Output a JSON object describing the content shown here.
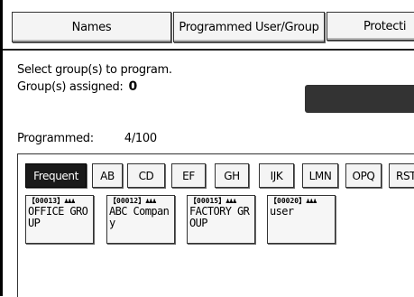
{
  "tabs": [
    "Names",
    "Programmed User/Group",
    "Protecti"
  ],
  "instruction": "Select group(s) to program.",
  "assigned_label": "Group(s) assigned:",
  "assigned_count": "0",
  "programmed_label": "Programmed:",
  "programmed_value": "4/100",
  "index_keys": [
    "Frequent",
    "AB",
    "CD",
    "EF",
    "GH",
    "IJK",
    "LMN",
    "OPQ",
    "RST"
  ],
  "active_index": "Frequent",
  "entries": [
    {
      "code": "【00013】",
      "icon": "group-icon",
      "name": "OFFICE GROUP"
    },
    {
      "code": "【00012】",
      "icon": "group-icon",
      "name": "ABC Company"
    },
    {
      "code": "【00015】",
      "icon": "group-icon",
      "name": "FACTORY GROUP"
    },
    {
      "code": "【00020】",
      "icon": "group-icon",
      "name": "user"
    }
  ]
}
